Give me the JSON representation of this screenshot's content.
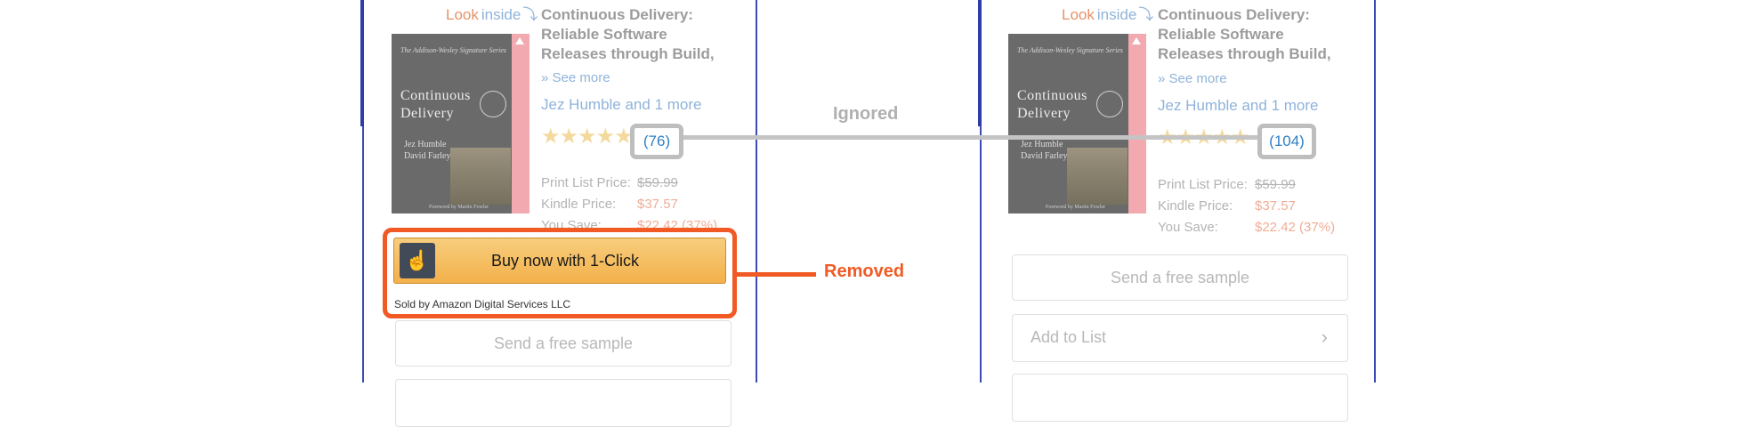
{
  "left": {
    "look": "Look",
    "inside": "inside",
    "cover_series": "The Addison-Wesley Signature Series",
    "cover_title": "Continuous Delivery",
    "cover_authors": "Jez Humble\nDavid Farley",
    "cover_foreword": "Foreword by Martin Fowler",
    "title": "Continuous Delivery: Reliable Software Releases through Build,",
    "see_more": "See more",
    "author": "Jez Humble and 1 more",
    "stars": "★★★★★",
    "review_count": "(76)",
    "print_label": "Print List Price:",
    "print_value": "$59.99",
    "kindle_label": "Kindle Price:",
    "kindle_value": "$37.57",
    "save_label": "You Save:",
    "save_value": "$22.42 (37%)",
    "buy_label": "Buy now with 1-Click",
    "sold_by": "Sold by Amazon Digital Services LLC",
    "sample_label": "Send a free sample"
  },
  "right": {
    "look": "Look",
    "inside": "inside",
    "cover_series": "The Addison-Wesley Signature Series",
    "cover_title": "Continuous Delivery",
    "cover_authors": "Jez Humble\nDavid Farley",
    "cover_foreword": "Foreword by Martin Fowler",
    "title": "Continuous Delivery: Reliable Software Releases through Build,",
    "see_more": "See more",
    "author": "Jez Humble and 1 more",
    "stars": "★★★★★",
    "review_count": "(104)",
    "print_label": "Print List Price:",
    "print_value": "$59.99",
    "kindle_label": "Kindle Price:",
    "kindle_value": "$37.57",
    "save_label": "You Save:",
    "save_value": "$22.42 (37%)",
    "sample_label": "Send a free sample",
    "add_to_list_label": "Add to List"
  },
  "annotations": {
    "ignored": "Ignored",
    "removed": "Removed",
    "accent_color": "#f15a24",
    "neutral_color": "#c4c4c4"
  }
}
